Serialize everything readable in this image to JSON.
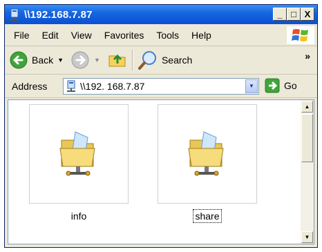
{
  "window": {
    "title": "\\\\192.168.7.87"
  },
  "title_controls": {
    "minimize": "_",
    "maximize": "□",
    "close": "X"
  },
  "menubar": {
    "items": [
      "File",
      "Edit",
      "View",
      "Favorites",
      "Tools",
      "Help"
    ]
  },
  "toolbar": {
    "back_label": "Back",
    "search_label": "Search",
    "overflow": "»"
  },
  "address": {
    "label": "Address",
    "value": "\\\\192. 168.7.87",
    "go_label": "Go"
  },
  "content": {
    "items": [
      {
        "name": "info"
      },
      {
        "name": "share",
        "selected": true
      }
    ]
  },
  "icons": [
    "network-drive-icon",
    "windows-flag-icon",
    "back-arrow-icon",
    "forward-arrow-icon",
    "up-folder-icon",
    "search-icon",
    "go-arrow-icon",
    "shared-folder-icon"
  ],
  "colors": {
    "titlebar": "#0b4fd2",
    "chrome": "#ece9d8",
    "back_button": "#3fa43a",
    "go_button": "#3fa43a"
  }
}
